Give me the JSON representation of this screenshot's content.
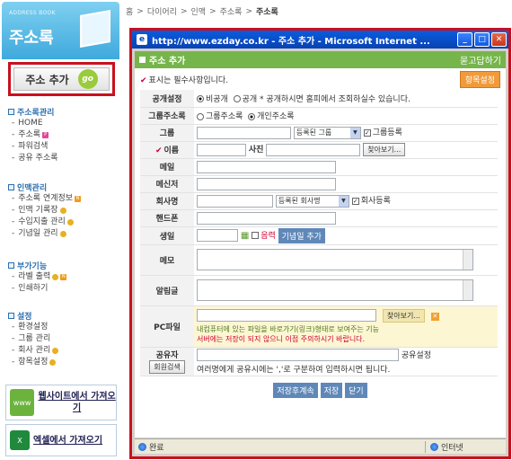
{
  "sidebar": {
    "banner_en": "ADDRESS BOOK",
    "banner_ko": "주소록",
    "add_button": "주소 추가",
    "go_label": "go",
    "sections": [
      {
        "title": "주소록관리",
        "items": [
          {
            "label": "HOME",
            "badge": ""
          },
          {
            "label": "주소록",
            "badge": "p"
          },
          {
            "label": "파워검색",
            "badge": ""
          },
          {
            "label": "공유 주소록",
            "badge": ""
          }
        ]
      },
      {
        "title": "인맥관리",
        "items": [
          {
            "label": "주소록 연계정보",
            "badge": "n"
          },
          {
            "label": "인맥 기록장",
            "badge": "m"
          },
          {
            "label": "수입지출 관리",
            "badge": "m"
          },
          {
            "label": "기념일 관리",
            "badge": "m"
          }
        ]
      },
      {
        "title": "부가기능",
        "items": [
          {
            "label": "라벨 출력",
            "badge": "mn"
          },
          {
            "label": "인쇄하기",
            "badge": ""
          }
        ]
      },
      {
        "title": "설정",
        "items": [
          {
            "label": "환경설정",
            "badge": ""
          },
          {
            "label": "그룹 관리",
            "badge": ""
          },
          {
            "label": "회사 관리",
            "badge": "m"
          },
          {
            "label": "항목설정",
            "badge": "m"
          }
        ]
      }
    ],
    "website_import": "웹사이트에서 가져오기",
    "excel_import": "엑셀에서 가져오기",
    "excel_icon_text": "X"
  },
  "breadcrumb": {
    "home": "홈",
    "items": [
      "다이어리",
      "인맥",
      "주소록"
    ],
    "current": "주소록"
  },
  "popup": {
    "title": "http://www.ezday.co.kr - 주소 추가 - Microsoft Internet ...",
    "header": "주소 추가",
    "help": "묻고답하기",
    "required_note": "표시는 필수사항입니다.",
    "field_settings_btn": "항목설정",
    "rows": {
      "visibility": {
        "label": "공개설정",
        "opt1": "비공개",
        "opt2": "공개 * 공개하시면 홈피에서 조회하실수 있습니다."
      },
      "group_addr": {
        "label": "그룹주소록",
        "opt1": "그룹주소록",
        "opt2": "개인주소록"
      },
      "group": {
        "label": "그룹",
        "select": "등록된 그룹",
        "check": "그룹등록"
      },
      "name": {
        "label": "이름",
        "photo": "사진",
        "browse": "찾아보기..."
      },
      "email": {
        "label": "메일"
      },
      "messenger": {
        "label": "메신저"
      },
      "company": {
        "label": "회사명",
        "select": "등록된 회사명",
        "check": "회사등록"
      },
      "phone": {
        "label": "핸드폰"
      },
      "birthday": {
        "label": "생일",
        "lunar": "음력",
        "add_anniv": "기념일 추가"
      },
      "memo": {
        "label": "메모"
      },
      "alert": {
        "label": "알림글"
      },
      "pcfile": {
        "label": "PC파일",
        "browse": "찾아보기...",
        "note1": "내컴퓨터에 있는 파일을 바로가기(링크)형태로 보여주는 기능",
        "note2": "서버에는 저장이 되지 않으니 이점 주의하시기 바랍니다."
      },
      "sharer": {
        "label": "공유자",
        "search": "회원검색",
        "share_setting": "공유설정",
        "note": "여러명에게 공유시에는 ','로 구분하여 입력하시면 됩니다."
      }
    },
    "buttons": {
      "save_continue": "저장후계속",
      "save": "저장",
      "close": "닫기"
    },
    "status": {
      "done": "완료",
      "zone": "인터넷"
    }
  }
}
